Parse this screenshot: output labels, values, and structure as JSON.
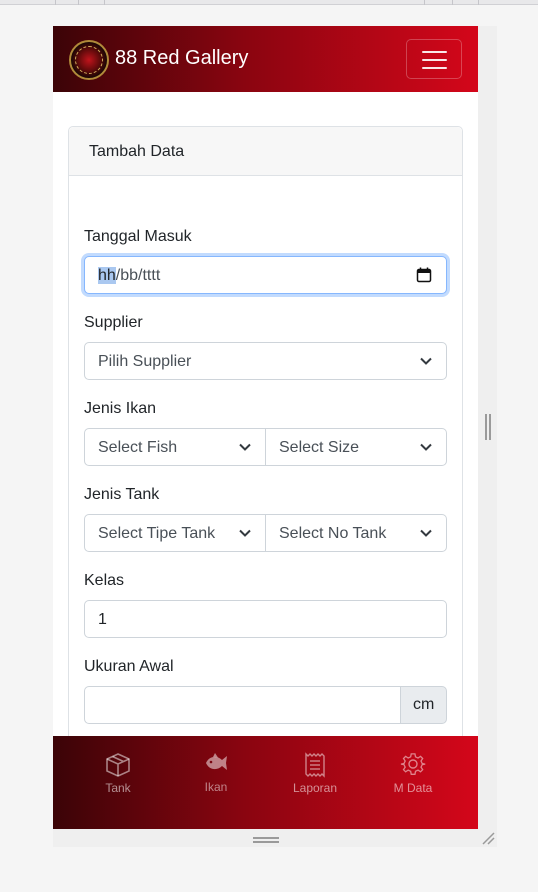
{
  "navbar": {
    "brand": "88 Red Gallery",
    "logo_icon": "dragon-logo-icon",
    "menu_icon": "hamburger-menu-icon"
  },
  "card": {
    "title": "Tambah Data"
  },
  "form": {
    "tanggal_masuk": {
      "label": "Tanggal Masuk",
      "value_highlight": "hh",
      "value_rest": "/bb/tttt",
      "icon": "calendar-icon"
    },
    "supplier": {
      "label": "Supplier",
      "selected": "Pilih Supplier"
    },
    "jenis_ikan": {
      "label": "Jenis Ikan",
      "fish_selected": "Select Fish",
      "size_selected": "Select Size"
    },
    "jenis_tank": {
      "label": "Jenis Tank",
      "tipe_selected": "Select Tipe Tank",
      "no_selected": "Select No Tank"
    },
    "kelas": {
      "label": "Kelas",
      "value": "1"
    },
    "ukuran_awal": {
      "label": "Ukuran Awal",
      "value": "",
      "unit": "cm"
    }
  },
  "bottom_nav": {
    "items": [
      {
        "label": "Tank",
        "icon": "box-icon",
        "active": false
      },
      {
        "label": "Ikan",
        "icon": "fish-icon",
        "active": true
      },
      {
        "label": "Laporan",
        "icon": "receipt-icon",
        "active": false
      },
      {
        "label": "M Data",
        "icon": "gear-icon",
        "active": false
      }
    ]
  },
  "colors": {
    "navbar_dark": "#3b0407",
    "navbar_bright": "#d4061a",
    "focus_border": "#86b7fe"
  }
}
